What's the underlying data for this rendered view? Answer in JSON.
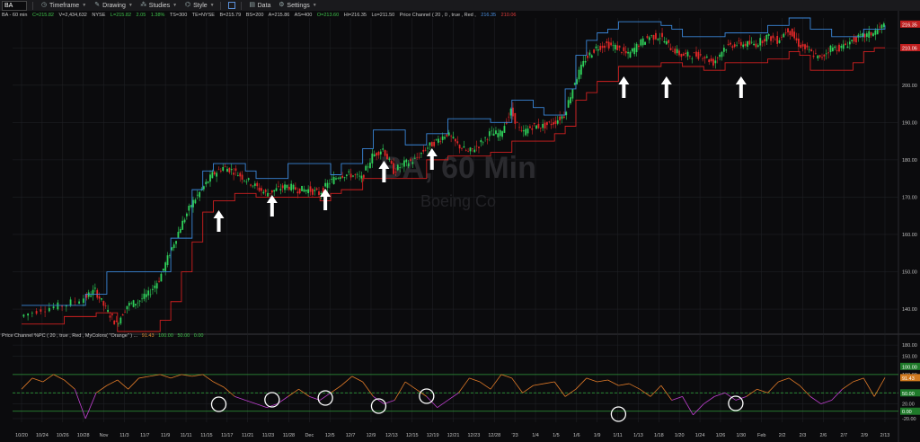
{
  "toolbar": {
    "symbol": "BA",
    "items": [
      {
        "label": "Timeframe",
        "icon": "clock-icon"
      },
      {
        "label": "Drawing",
        "icon": "pencil-icon"
      },
      {
        "label": "Studies",
        "icon": "studies-icon"
      },
      {
        "label": "Style",
        "icon": "style-icon"
      },
      {
        "label": "Data",
        "icon": "data-icon"
      },
      {
        "label": "Settings",
        "icon": "gear-icon"
      }
    ]
  },
  "header": {
    "title": "BA - 60 min",
    "close": "C=215.82",
    "volume": "V=2,434,632",
    "exchange": "NYSE",
    "last": "L=215.82",
    "change": "2.05",
    "change_pct": "1.38%",
    "ts": "TS=300",
    "te": "TE=NYSE",
    "bid": "B=215.79",
    "bid_size": "BS=200",
    "ask": "A=215.86",
    "ask_size": "AS=400",
    "open": "O=213.60",
    "high": "Hi=216.35",
    "low": "Lo=211.50",
    "study": "Price Channel ( 20 , 0 , true , Red ,",
    "upper_val": "216.35",
    "lower_val": "210.06"
  },
  "watermark": {
    "line1": "BA, 60 Min",
    "line2": "Boeing Co"
  },
  "indicator": {
    "title": "Price Channel %PC ( 20 , true , Red , MyColors( \"Orange\" ) ...",
    "value": "91.43",
    "level_high": "100.00",
    "level_mid": "50.00",
    "level_low": "0.00"
  },
  "price_axis_badges": {
    "upper": "216.35",
    "lower": "210.06"
  },
  "indicator_axis_badges": {
    "value": "91.43",
    "level": "50.00",
    "high": "100.00",
    "low": "0.00"
  },
  "colors": {
    "up_candle": "#2fd05a",
    "down_candle": "#e22828",
    "upper_channel": "#3a86d8",
    "lower_channel": "#d02020",
    "pc_line_high": "#e07a28",
    "pc_line_low": "#c040d0",
    "level_green": "#2f9a3a",
    "arrow": "#ffffff"
  },
  "chart_data": [
    {
      "type": "line",
      "title": "BA - 60 min",
      "x_tick_labels": [
        "10/20",
        "10/24",
        "10/26",
        "10/28",
        "Nov",
        "11/3",
        "11/7",
        "11/9",
        "11/11",
        "11/15",
        "11/17",
        "11/21",
        "11/23",
        "11/28",
        "Dec",
        "12/5",
        "12/7",
        "12/9",
        "12/13",
        "12/15",
        "12/19",
        "12/21",
        "12/23",
        "12/28",
        "'23",
        "1/4",
        "1/5",
        "1/6",
        "1/9",
        "1/11",
        "1/13",
        "1/18",
        "1/20",
        "1/24",
        "1/26",
        "1/30",
        "Feb",
        "2/2",
        "2/3",
        "2/6",
        "2/7",
        "2/9",
        "2/13"
      ],
      "y_ticks": [
        140.0,
        150.0,
        160.0,
        170.0,
        180.0,
        190.0,
        200.0,
        210.0
      ],
      "ylim": [
        134,
        218
      ],
      "series": [
        {
          "name": "Price",
          "points": [
            [
              0,
              138
            ],
            [
              2,
              140
            ],
            [
              4,
              141
            ],
            [
              6,
              143
            ],
            [
              7,
              145
            ],
            [
              8,
              140
            ],
            [
              9,
              136
            ],
            [
              10,
              141
            ],
            [
              11,
              142
            ],
            [
              12,
              144
            ],
            [
              13,
              148
            ],
            [
              14,
              155
            ],
            [
              15,
              162
            ],
            [
              16,
              168
            ],
            [
              17,
              172
            ],
            [
              18,
              176
            ],
            [
              19,
              178
            ],
            [
              20,
              177
            ],
            [
              21,
              175
            ],
            [
              22,
              173
            ],
            [
              23,
              171
            ],
            [
              24,
              172
            ],
            [
              25,
              173
            ],
            [
              26,
              172
            ],
            [
              27,
              172
            ],
            [
              28,
              171
            ],
            [
              29,
              174
            ],
            [
              30,
              176
            ],
            [
              31,
              176
            ],
            [
              32,
              175
            ],
            [
              33,
              181
            ],
            [
              34,
              183
            ],
            [
              35,
              177
            ],
            [
              36,
              179
            ],
            [
              37,
              180
            ],
            [
              38,
              183
            ],
            [
              39,
              185
            ],
            [
              40,
              187
            ],
            [
              41,
              184
            ],
            [
              42,
              182
            ],
            [
              43,
              184
            ],
            [
              44,
              187
            ],
            [
              45,
              187
            ],
            [
              46,
              193
            ],
            [
              47,
              187
            ],
            [
              48,
              189
            ],
            [
              49,
              189
            ],
            [
              50,
              190
            ],
            [
              51,
              192
            ],
            [
              52,
              201
            ],
            [
              53,
              207
            ],
            [
              54,
              210
            ],
            [
              55,
              211
            ],
            [
              56,
              210
            ],
            [
              57,
              208
            ],
            [
              58,
              211
            ],
            [
              59,
              213
            ],
            [
              60,
              213
            ],
            [
              61,
              210
            ],
            [
              62,
              208
            ],
            [
              63,
              208
            ],
            [
              64,
              208
            ],
            [
              65,
              206
            ],
            [
              66,
              210
            ],
            [
              67,
              211
            ],
            [
              68,
              211
            ],
            [
              69,
              211
            ],
            [
              70,
              213
            ],
            [
              71,
              212
            ],
            [
              72,
              215
            ],
            [
              73,
              211
            ],
            [
              74,
              209
            ],
            [
              75,
              207
            ],
            [
              76,
              210
            ],
            [
              77,
              210
            ],
            [
              78,
              212
            ],
            [
              79,
              213
            ],
            [
              80,
              214
            ],
            [
              81,
              216
            ]
          ]
        },
        {
          "name": "Upper channel",
          "points": [
            [
              0,
              141
            ],
            [
              6,
              144
            ],
            [
              8,
              150
            ],
            [
              12,
              150
            ],
            [
              14,
              159
            ],
            [
              16,
              172
            ],
            [
              17,
              177
            ],
            [
              18,
              179
            ],
            [
              20,
              179
            ],
            [
              21,
              177
            ],
            [
              22,
              175
            ],
            [
              24,
              175
            ],
            [
              25,
              179
            ],
            [
              27,
              179
            ],
            [
              29,
              176
            ],
            [
              30,
              179
            ],
            [
              32,
              183
            ],
            [
              33,
              188
            ],
            [
              34,
              188
            ],
            [
              36,
              184
            ],
            [
              38,
              187
            ],
            [
              40,
              191
            ],
            [
              42,
              191
            ],
            [
              44,
              190
            ],
            [
              46,
              196
            ],
            [
              48,
              194
            ],
            [
              49,
              192
            ],
            [
              50,
              192
            ],
            [
              51,
              199
            ],
            [
              52,
              208
            ],
            [
              53,
              212
            ],
            [
              54,
              214
            ],
            [
              55,
              215
            ],
            [
              56,
              217
            ],
            [
              58,
              217
            ],
            [
              59,
              217
            ],
            [
              60,
              216
            ],
            [
              61,
              215
            ],
            [
              62,
              213
            ],
            [
              64,
              213
            ],
            [
              65,
              213
            ],
            [
              66,
              214
            ],
            [
              68,
              214
            ],
            [
              70,
              216
            ],
            [
              72,
              218
            ],
            [
              73,
              218
            ],
            [
              74,
              215
            ],
            [
              76,
              213
            ],
            [
              78,
              213
            ],
            [
              79,
              215
            ],
            [
              80,
              215
            ],
            [
              81,
              216
            ]
          ]
        },
        {
          "name": "Lower channel",
          "points": [
            [
              0,
              136
            ],
            [
              4,
              138
            ],
            [
              7,
              139
            ],
            [
              9,
              134
            ],
            [
              11,
              134
            ],
            [
              13,
              137
            ],
            [
              14,
              142
            ],
            [
              15,
              150
            ],
            [
              16,
              158
            ],
            [
              17,
              166
            ],
            [
              18,
              169
            ],
            [
              20,
              171
            ],
            [
              22,
              170
            ],
            [
              24,
              170
            ],
            [
              26,
              170
            ],
            [
              27,
              170
            ],
            [
              28,
              169
            ],
            [
              29,
              171
            ],
            [
              30,
              172
            ],
            [
              32,
              175
            ],
            [
              34,
              175
            ],
            [
              36,
              175
            ],
            [
              38,
              180
            ],
            [
              40,
              181
            ],
            [
              42,
              181
            ],
            [
              44,
              182
            ],
            [
              46,
              185
            ],
            [
              48,
              185
            ],
            [
              50,
              187
            ],
            [
              51,
              189
            ],
            [
              52,
              196
            ],
            [
              53,
              198
            ],
            [
              54,
              201
            ],
            [
              56,
              205
            ],
            [
              58,
              205
            ],
            [
              60,
              206
            ],
            [
              61,
              206
            ],
            [
              62,
              205
            ],
            [
              63,
              205
            ],
            [
              64,
              204
            ],
            [
              66,
              206
            ],
            [
              68,
              206
            ],
            [
              69,
              206
            ],
            [
              70,
              207
            ],
            [
              72,
              209
            ],
            [
              73,
              208
            ],
            [
              74,
              204
            ],
            [
              76,
              204
            ],
            [
              78,
              206
            ],
            [
              79,
              209
            ],
            [
              80,
              210
            ],
            [
              81,
              210
            ]
          ]
        }
      ]
    },
    {
      "type": "line",
      "title": "Price Channel %PC",
      "y_ticks": [
        -20.0,
        20.0,
        50.0,
        100.0,
        150.0,
        180.0
      ],
      "ylim": [
        -30,
        195
      ],
      "reference_levels": [
        100.0,
        50.0,
        0.0
      ],
      "series": [
        {
          "name": "%PC",
          "values": [
            60,
            90,
            80,
            100,
            85,
            60,
            -20,
            50,
            70,
            85,
            60,
            90,
            95,
            100,
            90,
            100,
            95,
            100,
            80,
            65,
            40,
            30,
            20,
            10,
            20,
            40,
            60,
            40,
            30,
            50,
            70,
            95,
            80,
            40,
            20,
            30,
            80,
            60,
            40,
            10,
            30,
            50,
            90,
            80,
            60,
            100,
            90,
            50,
            70,
            75,
            80,
            40,
            60,
            90,
            80,
            85,
            70,
            75,
            60,
            40,
            70,
            30,
            40,
            -10,
            20,
            40,
            50,
            30,
            40,
            60,
            50,
            80,
            90,
            70,
            40,
            20,
            30,
            60,
            80,
            90,
            40,
            91.43
          ]
        }
      ]
    }
  ],
  "annotations": {
    "arrows": [
      "arrow-1",
      "arrow-2",
      "arrow-3",
      "arrow-4",
      "arrow-5",
      "arrow-6",
      "arrow-7",
      "arrow-8"
    ],
    "circles": [
      "circle-1",
      "circle-2",
      "circle-3",
      "circle-4",
      "circle-5",
      "circle-6",
      "circle-7"
    ]
  }
}
